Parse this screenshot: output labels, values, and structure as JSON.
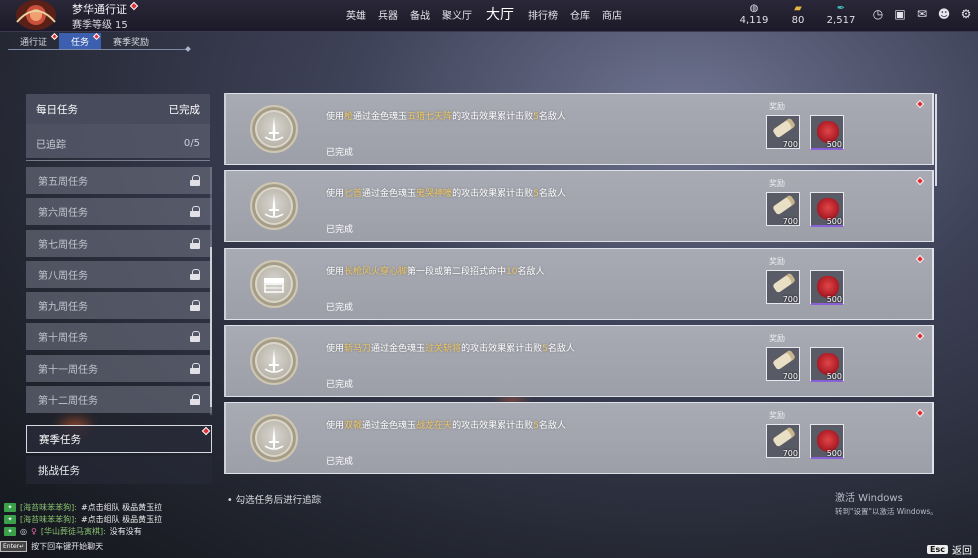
{
  "header": {
    "pass_title": "梦华通行证",
    "season_level_label": "赛季等级",
    "season_level": "15"
  },
  "nav": {
    "items": [
      "英雄",
      "兵器",
      "备战",
      "聚义厅",
      "大厅",
      "排行榜",
      "仓库",
      "商店"
    ]
  },
  "currencies": [
    {
      "icon": "coin-icon",
      "value": "4,119"
    },
    {
      "icon": "gold-ingot-icon",
      "value": "80"
    },
    {
      "icon": "feather-icon",
      "value": "2,517"
    }
  ],
  "subtabs": [
    "通行证",
    "任务",
    "赛季奖励"
  ],
  "left_panel": {
    "daily": {
      "title": "每日任务",
      "status": "已完成",
      "tracked_label": "已追踪",
      "tracked_value": "0/5"
    },
    "weeks": [
      "第五周任务",
      "第六周任务",
      "第七周任务",
      "第八周任务",
      "第九周任务",
      "第十周任务",
      "第十一周任务",
      "第十二周任务"
    ],
    "season": "赛季任务",
    "challenge": "挑战任务"
  },
  "quests": [
    {
      "medal": "sword-medal-icon",
      "p1": "使用",
      "h1": "枪",
      "p2": "通过金色魂玉",
      "h2": "五猎七天阵",
      "p3": "的攻击效果累计击败",
      "h3": "5",
      "p4": "名敌人",
      "status": "已完成",
      "reward_label": "奖励",
      "rewards": [
        "700",
        "500"
      ]
    },
    {
      "medal": "sword-medal-icon",
      "p1": "使用",
      "h1": "匕首",
      "p2": "通过金色魂玉",
      "h2": "鬼哭神嚎",
      "p3": "的攻击效果累计击败",
      "h3": "5",
      "p4": "名敌人",
      "status": "已完成",
      "reward_label": "奖励",
      "rewards": [
        "700",
        "500"
      ]
    },
    {
      "medal": "chest-medal-icon",
      "p1": "使用",
      "h1": "长枪风火穿心脚",
      "p2": "第一段或第二段招式命中",
      "h2": "10",
      "p3": "名敌人",
      "h3": "",
      "p4": "",
      "status": "已完成",
      "reward_label": "奖励",
      "rewards": [
        "700",
        "500"
      ]
    },
    {
      "medal": "sword-medal-icon",
      "p1": "使用",
      "h1": "斩马刀",
      "p2": "通过金色魂玉",
      "h2": "过关斩将",
      "p3": "的攻击效果累计击败",
      "h3": "5",
      "p4": "名敌人",
      "status": "已完成",
      "reward_label": "奖励",
      "rewards": [
        "700",
        "500"
      ]
    },
    {
      "medal": "sword-medal-icon",
      "p1": "使用",
      "h1": "双戟",
      "p2": "通过金色魂玉",
      "h2": "战龙在天",
      "p3": "的攻击效果累计击败",
      "h3": "5",
      "p4": "名敌人",
      "status": "已完成",
      "reward_label": "奖励",
      "rewards": [
        "700",
        "500"
      ]
    }
  ],
  "hint": "• 勾选任务后进行追踪",
  "watermark": {
    "line1": "激活 Windows",
    "line2": "转到\"设置\"以激活 Windows。"
  },
  "chat": [
    {
      "name": "[海苔味苯苯狗]:",
      "msg": "#点击组队 极品黄玉拉"
    },
    {
      "name": "[海苔味苯苯狗]:",
      "msg": "#点击组队 极品黄玉拉"
    },
    {
      "name": "[华山葬徒马寅棋]:",
      "msg": "没有没有"
    }
  ],
  "chat_input": {
    "key": "Enter↵",
    "hint": "按下回车键开始聊天"
  },
  "back": {
    "key": "Esc",
    "label": "返回"
  },
  "colors": {
    "highlight": "#f0c860",
    "active_tab": "#3d5fb0",
    "alert": "#d8343a"
  }
}
